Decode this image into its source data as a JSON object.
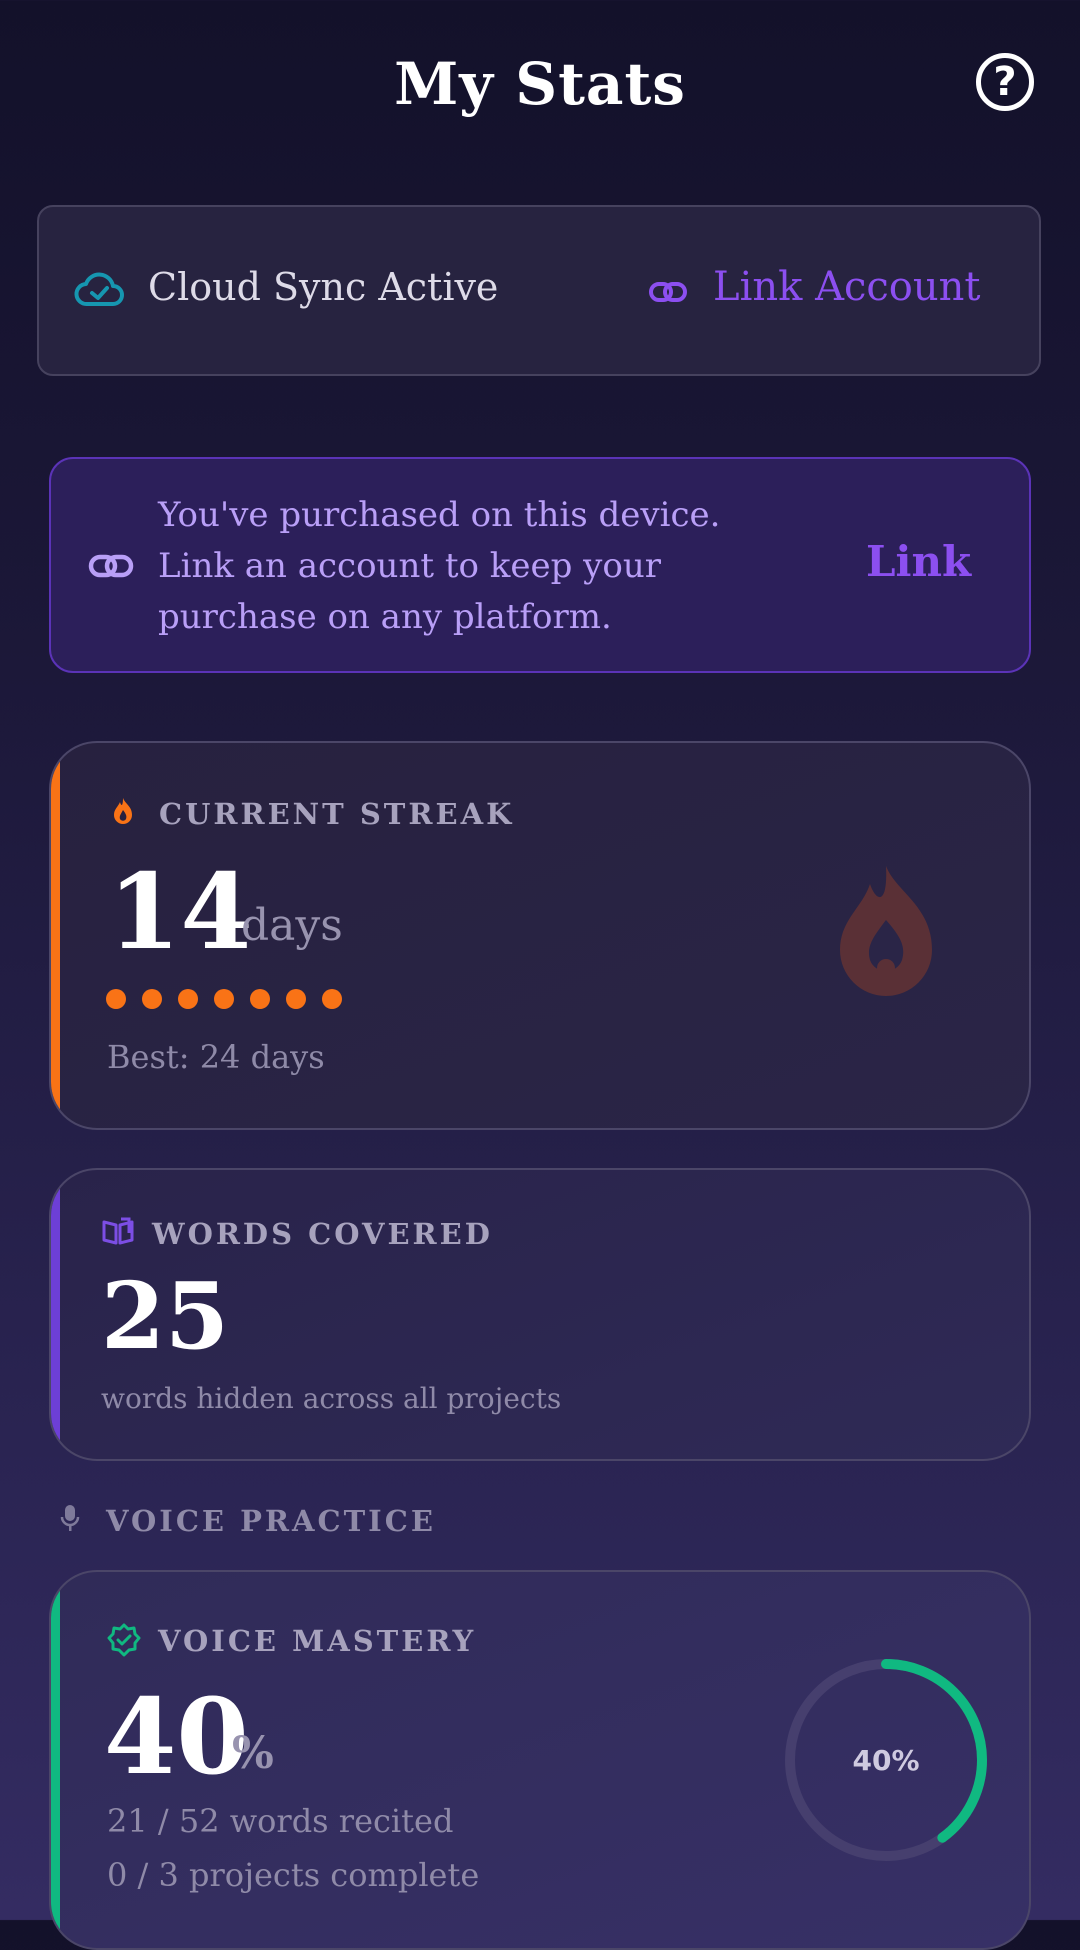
{
  "header": {
    "title": "My Stats",
    "help_icon": "question-circle-icon"
  },
  "sync": {
    "status_label": "Cloud Sync Active",
    "status_icon": "cloud-check-icon",
    "link_label": "Link Account",
    "link_icon": "link-icon"
  },
  "banner": {
    "message": "You've purchased on this device. Link an account to keep your purchase on any platform.",
    "action_label": "Link",
    "icon": "link-icon"
  },
  "streak": {
    "label": "CURRENT STREAK",
    "value": "14",
    "unit": "days",
    "dots_filled": 7,
    "best": "Best: 24 days",
    "accent": "#f97316"
  },
  "words": {
    "label": "WORDS COVERED",
    "value": "25",
    "caption": "words hidden across all projects",
    "accent": "#6d3fd6"
  },
  "voice_section": {
    "label": "VOICE PRACTICE",
    "icon": "microphone-icon"
  },
  "voice_mastery": {
    "label": "VOICE MASTERY",
    "value": "40",
    "unit": "%",
    "ring_label": "40%",
    "progress": 0.4,
    "recited": "21 / 52 words recited",
    "projects": "0 / 3 projects complete",
    "accent": "#10b981"
  }
}
